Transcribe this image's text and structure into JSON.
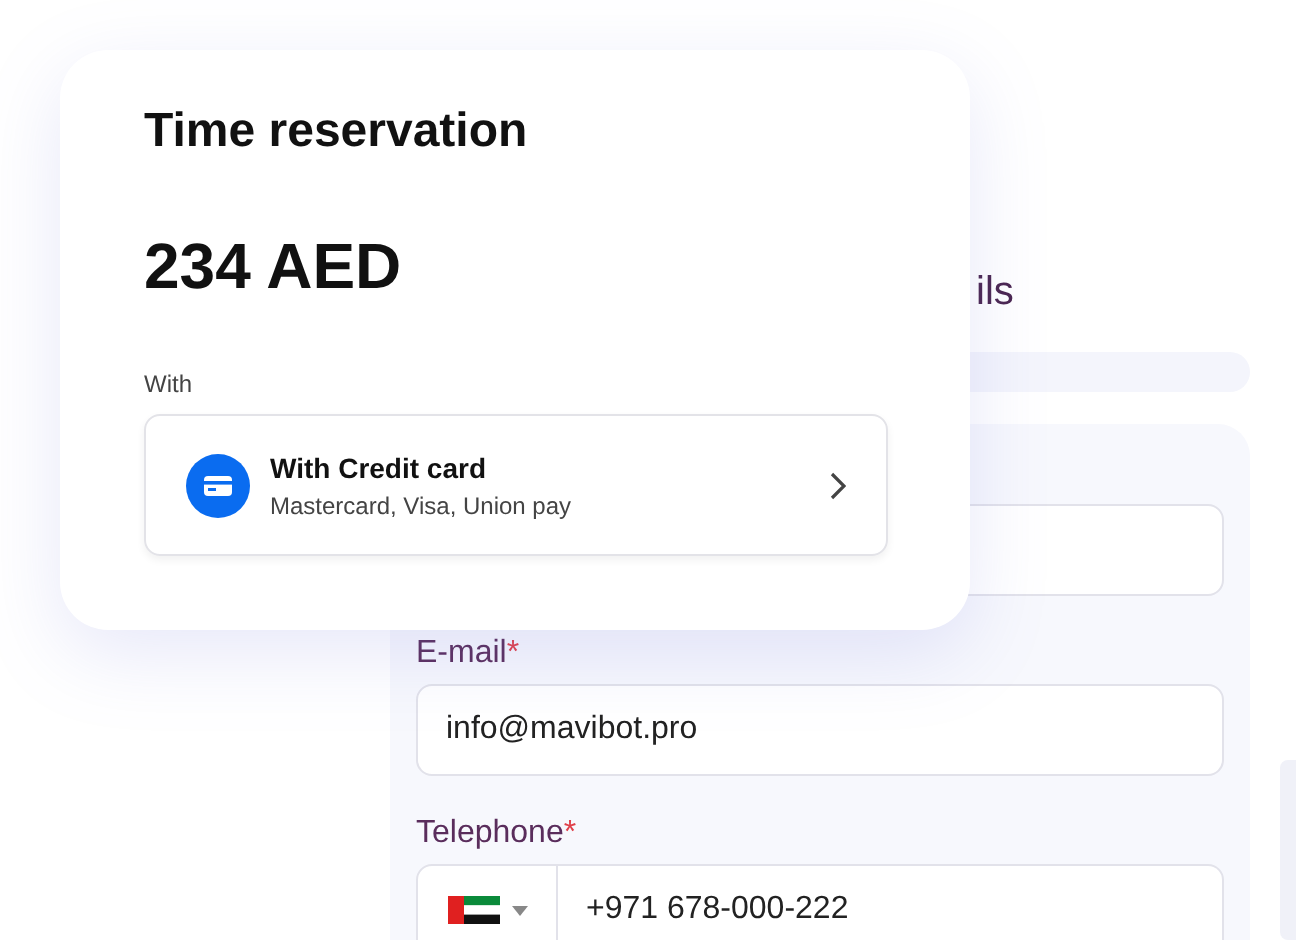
{
  "step_heading": "ils",
  "payment_card": {
    "title": "Time reservation",
    "amount": "234 AED",
    "method_label": "With",
    "method": {
      "title": "With Credit card",
      "subtitle": "Mastercard, Visa, Union pay"
    }
  },
  "form": {
    "fields": [
      {
        "kind": "text"
      },
      {
        "kind": "text",
        "label": "E-mail",
        "required_mark": "*",
        "value": "info@mavibot.pro"
      },
      {
        "kind": "phone",
        "label": "Telephone",
        "required_mark": "*",
        "value": "+971 678-000-222"
      }
    ]
  }
}
